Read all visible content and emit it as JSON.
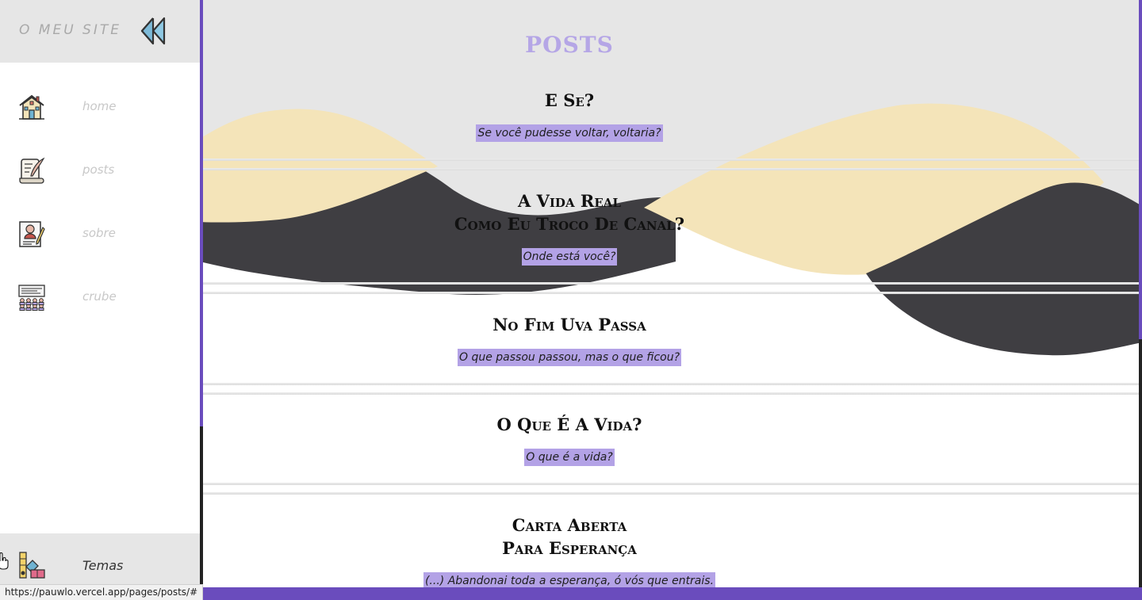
{
  "sidebar": {
    "site_title": "O MEU SITE",
    "collapse_icon": "double-chevron-left-icon",
    "items": [
      {
        "label": "home",
        "icon": "house-icon"
      },
      {
        "label": "posts",
        "icon": "scroll-quill-icon"
      },
      {
        "label": "sobre",
        "icon": "profile-document-icon"
      },
      {
        "label": "crube",
        "icon": "audience-icon"
      }
    ],
    "footer": {
      "label": "Temas",
      "icon": "color-palette-icon"
    }
  },
  "main": {
    "heading": "POSTS",
    "posts": [
      {
        "title_lines": [
          "E Se?"
        ],
        "subtitle": "Se você pudesse voltar, voltaria?"
      },
      {
        "title_lines": [
          "A Vida Real",
          "Como Eu Troco De Canal?"
        ],
        "subtitle": "Onde está você?"
      },
      {
        "title_lines": [
          "No Fim Uva Passa"
        ],
        "subtitle": "O que passou passou, mas o que ficou?"
      },
      {
        "title_lines": [
          "O Que É A Vida?"
        ],
        "subtitle": "O que é a vida?"
      },
      {
        "title_lines": [
          "Carta Aberta",
          "Para Esperança"
        ],
        "subtitle": "(...) Abandonai toda a esperança, ó vós que entrais."
      }
    ]
  },
  "colors": {
    "accent": "#6a4cbd",
    "heading": "#b5a6e6",
    "highlight": "#b3a2e6",
    "wave_cream": "#f4e4b9",
    "wave_dark": "#3f3e42",
    "header_bg": "#e6e6e6"
  },
  "status_bar": {
    "url": "https://pauwlo.vercel.app/pages/posts/#"
  }
}
